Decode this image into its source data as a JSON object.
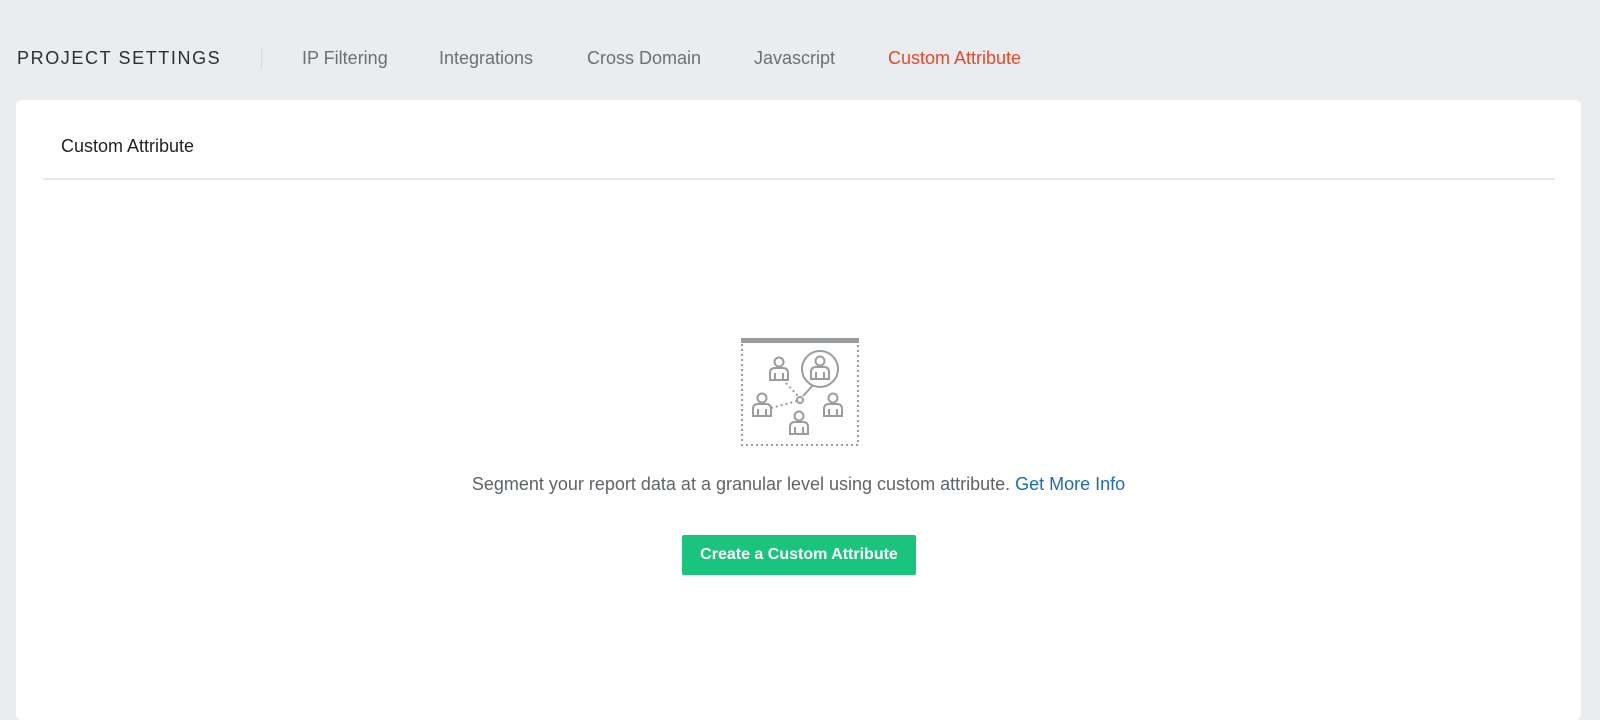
{
  "header": {
    "section_title": "PROJECT SETTINGS",
    "tabs": [
      {
        "label": "IP Filtering"
      },
      {
        "label": "Integrations"
      },
      {
        "label": "Cross Domain"
      },
      {
        "label": "Javascript"
      },
      {
        "label": "Custom Attribute"
      }
    ],
    "active_tab": "Custom Attribute"
  },
  "card": {
    "title": "Custom Attribute",
    "empty_state": {
      "illustration": "people-network-icon",
      "message": "Segment your report data at a granular level using custom attribute.",
      "link_label": "Get More Info",
      "button_label": "Create a Custom Attribute"
    }
  },
  "colors": {
    "background": "#e9edf0",
    "active_tab": "#e8472a",
    "link": "#1f6bb8",
    "primary_button": "#1bc47d"
  }
}
